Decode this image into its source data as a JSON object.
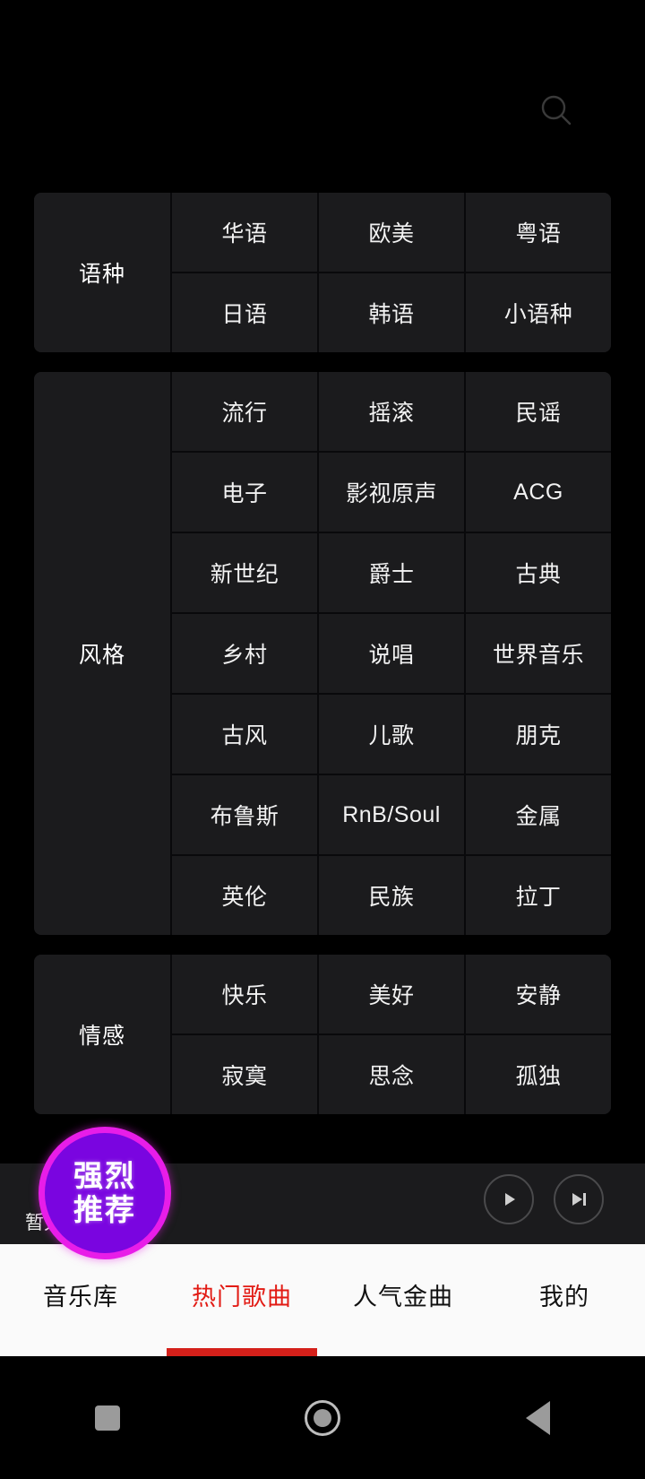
{
  "header": {
    "search_icon": "search-icon"
  },
  "categories": [
    {
      "label": "语种",
      "rows": [
        [
          "华语",
          "欧美",
          "粤语"
        ],
        [
          "日语",
          "韩语",
          "小语种"
        ]
      ]
    },
    {
      "label": "风格",
      "rows": [
        [
          "流行",
          "摇滚",
          "民谣"
        ],
        [
          "电子",
          "影视原声",
          "ACG"
        ],
        [
          "新世纪",
          "爵士",
          "古典"
        ],
        [
          "乡村",
          "说唱",
          "世界音乐"
        ],
        [
          "古风",
          "儿歌",
          "朋克"
        ],
        [
          "布鲁斯",
          "RnB/Soul",
          "金属"
        ],
        [
          "英伦",
          "民族",
          "拉丁"
        ]
      ]
    },
    {
      "label": "情感",
      "rows": [
        [
          "快乐",
          "美好",
          "安静"
        ],
        [
          "寂寞",
          "思念",
          "孤独"
        ]
      ]
    }
  ],
  "player": {
    "title": "暂无歌曲播放",
    "play_icon": "play-icon",
    "next_icon": "next-track-icon"
  },
  "tabbar": {
    "active_index": 1,
    "accent_color": "#d4201a",
    "items": [
      {
        "label": "音乐库"
      },
      {
        "label": "热门歌曲"
      },
      {
        "label": "人气金曲"
      },
      {
        "label": "我的"
      }
    ]
  },
  "sticker": {
    "line1": "强烈",
    "line2": "推荐",
    "fill_color": "#7a05e0",
    "border_color": "#e81de8"
  },
  "navbar": {
    "recents": "recents-square-icon",
    "home": "home-circle-icon",
    "back": "back-triangle-icon"
  }
}
